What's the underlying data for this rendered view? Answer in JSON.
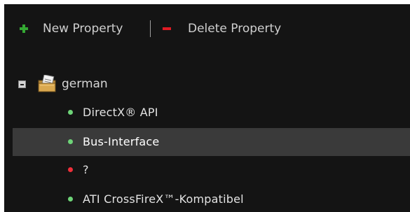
{
  "toolbar": {
    "new_label": "New Property",
    "separator": "|",
    "delete_label": "Delete Property"
  },
  "tree": {
    "root": {
      "label": "german",
      "expanded": true,
      "icon": "document-folder-icon"
    },
    "items": [
      {
        "label": "DirectX® API",
        "status": "green",
        "selected": false
      },
      {
        "label": "Bus-Interface",
        "status": "green",
        "selected": true
      },
      {
        "label": "?",
        "status": "red",
        "selected": false
      },
      {
        "label": "ATI CrossFireX™-Kompatibel",
        "status": "green",
        "selected": false
      }
    ]
  },
  "colors": {
    "panel_bg": "#141414",
    "selection_bg": "#3a3a3a",
    "add_green": "#34a833",
    "delete_red": "#e01b24",
    "status_green": "#6ed478",
    "status_red": "#ef2f3a"
  }
}
